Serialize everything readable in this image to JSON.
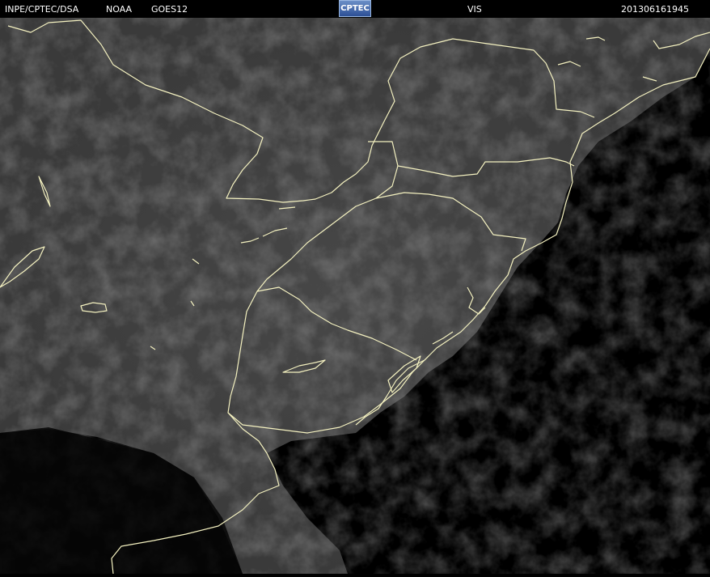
{
  "header": {
    "source": "INPE/CPTEC/DSA",
    "agency": "NOAA",
    "satellite": "GOES12",
    "logo": "CPTEC",
    "channel": "VIS",
    "timestamp": "201306161945"
  },
  "colors": {
    "background": "#000000",
    "boundary": "#f4f1c0",
    "cloud": "#3c3c3c"
  }
}
